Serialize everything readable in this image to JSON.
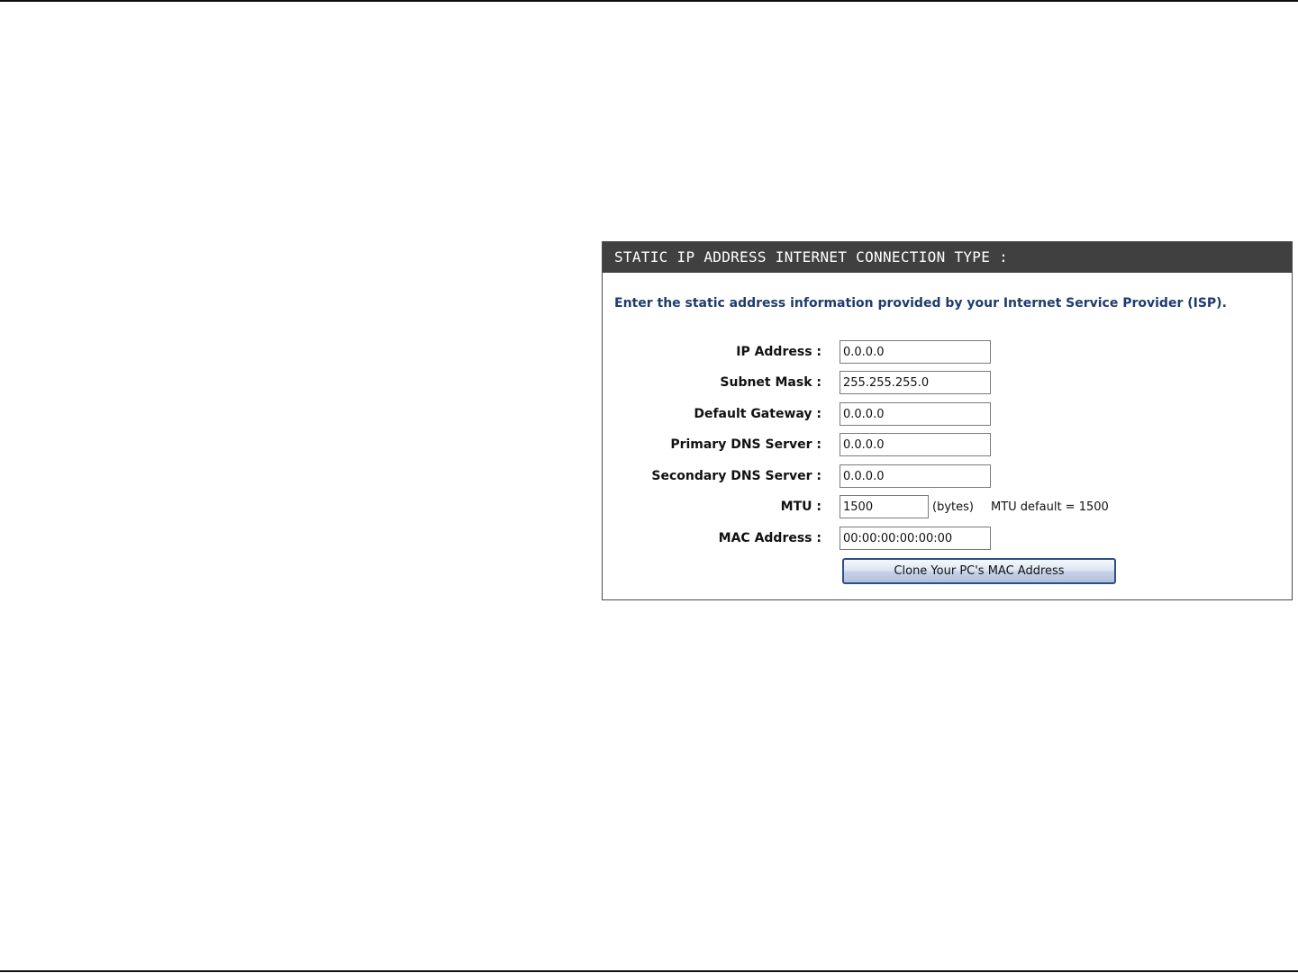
{
  "panel": {
    "title": "STATIC IP ADDRESS INTERNET CONNECTION TYPE :",
    "intro": "Enter the static address information provided by your Internet Service Provider (ISP)."
  },
  "form": {
    "ip_address": {
      "label": "IP Address :",
      "value": "0.0.0.0"
    },
    "subnet_mask": {
      "label": "Subnet Mask :",
      "value": "255.255.255.0"
    },
    "default_gateway": {
      "label": "Default Gateway :",
      "value": "0.0.0.0"
    },
    "primary_dns": {
      "label": "Primary DNS Server :",
      "value": "0.0.0.0"
    },
    "secondary_dns": {
      "label": "Secondary DNS Server :",
      "value": "0.0.0.0"
    },
    "mtu": {
      "label": "MTU :",
      "value": "1500",
      "unit": "(bytes)",
      "default_note": "MTU default = 1500"
    },
    "mac_address": {
      "label": "MAC Address :",
      "value": "00:00:00:00:00:00"
    }
  },
  "buttons": {
    "clone_mac": "Clone Your PC's MAC Address"
  },
  "colors": {
    "header_bg": "#404040",
    "intro_text": "#1f3c6e",
    "button_border": "#2f4f86"
  }
}
